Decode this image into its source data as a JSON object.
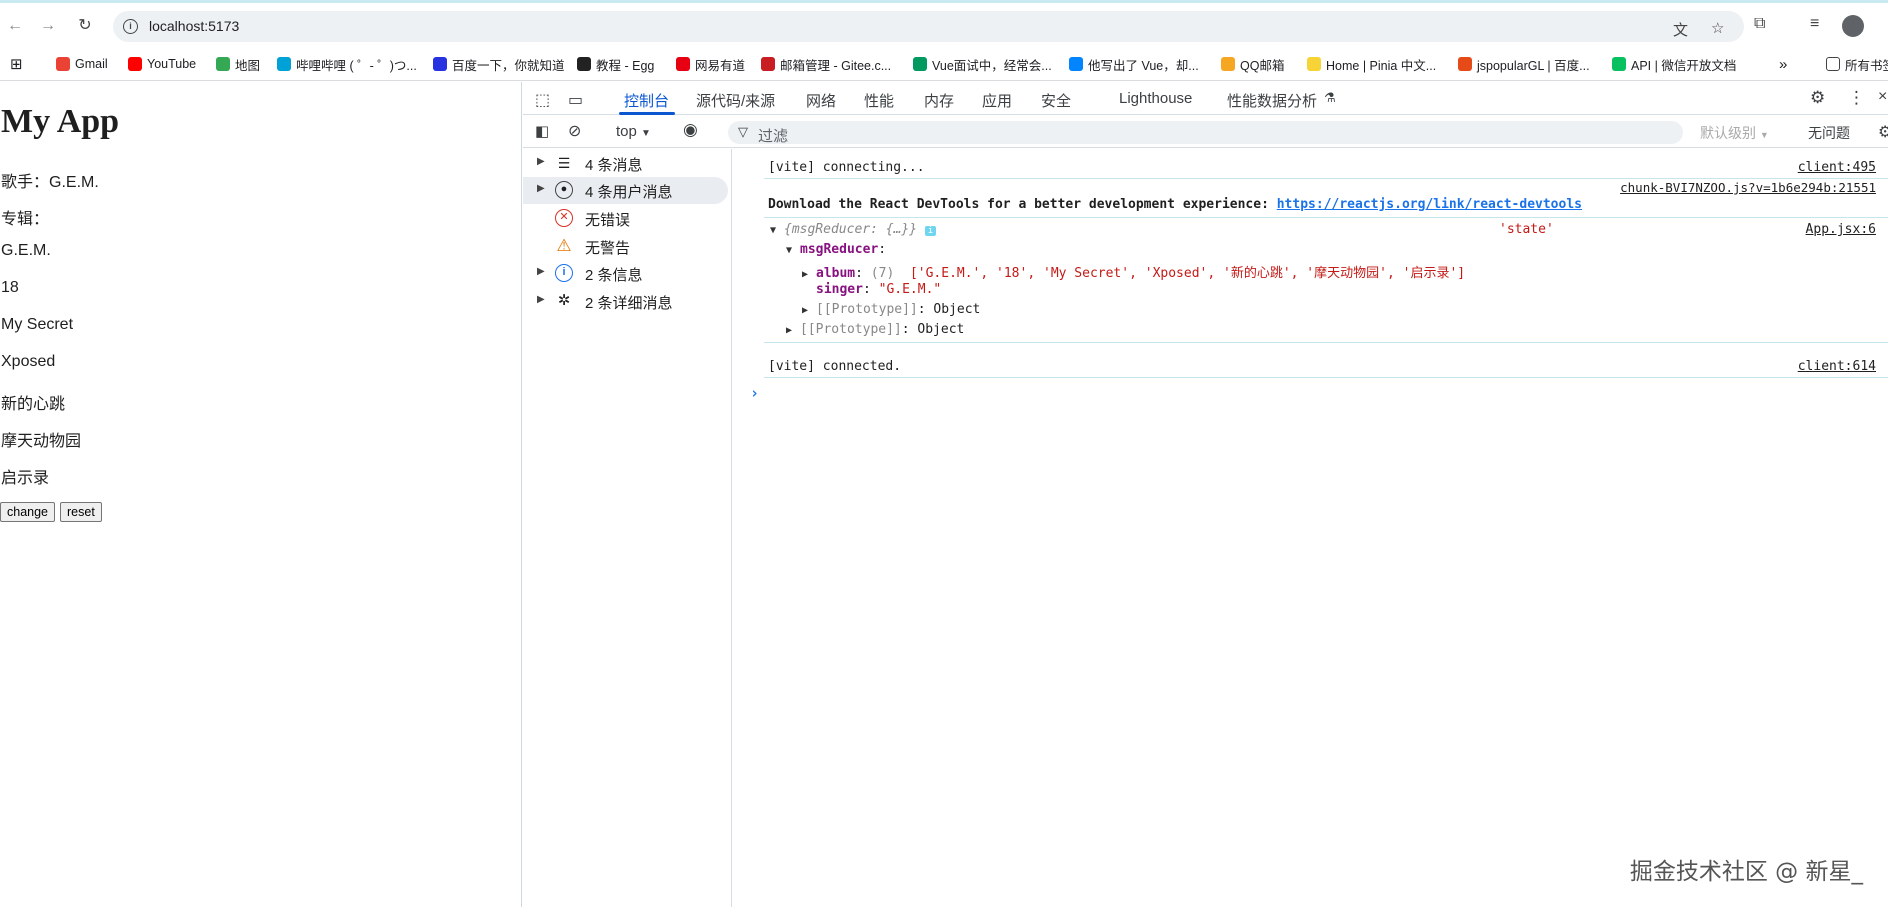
{
  "browser": {
    "url": "localhost:5173",
    "bookmarks": [
      {
        "label": "Gmail",
        "color": "#ea4335"
      },
      {
        "label": "YouTube",
        "color": "#ff0000"
      },
      {
        "label": "地图",
        "color": "#34a853"
      },
      {
        "label": "哔哩哔哩 ( ゜- ゜)つ...",
        "color": "#00a1d6"
      },
      {
        "label": "百度一下，你就知道",
        "color": "#2932e1"
      },
      {
        "label": "教程 - Egg",
        "color": "#222222"
      },
      {
        "label": "网易有道",
        "color": "#e60012"
      },
      {
        "label": "邮箱管理 - Gitee.c...",
        "color": "#c71d23"
      },
      {
        "label": "Vue面试中，经常会...",
        "color": "#009a61"
      },
      {
        "label": "他写出了 Vue，却...",
        "color": "#0084ff"
      },
      {
        "label": "QQ邮箱",
        "color": "#f5a623"
      },
      {
        "label": "Home | Pinia 中文...",
        "color": "#f7d336"
      },
      {
        "label": "jspopularGL | 百度...",
        "color": "#e64a19"
      },
      {
        "label": "API | 微信开放文档",
        "color": "#07c160"
      }
    ],
    "bookmarks_more": "»",
    "all_bookmarks": "所有书签"
  },
  "page": {
    "title": "My App",
    "singer_line": "歌手：G.E.M.",
    "album_label": "专辑：",
    "albums": [
      "G.E.M.",
      "18",
      "My Secret",
      "Xposed",
      "新的心跳",
      "摩天动物园",
      "启示录"
    ],
    "change_button": "change",
    "reset_button": "reset"
  },
  "devtools": {
    "tabs": [
      "控制台",
      "源代码/来源",
      "网络",
      "性能",
      "内存",
      "应用",
      "安全",
      "Lighthouse",
      "性能数据分析"
    ],
    "context": "top",
    "filter_placeholder": "过滤",
    "level": "默认级别",
    "issues": "无问题",
    "sidebar": [
      {
        "label": "4 条消息",
        "icon": "list-icon"
      },
      {
        "label": "4 条用户消息",
        "icon": "user-icon"
      },
      {
        "label": "无错误",
        "icon": "error-icon"
      },
      {
        "label": "无警告",
        "icon": "warning-icon"
      },
      {
        "label": "2 条信息",
        "icon": "info-icon"
      },
      {
        "label": "2 条详细消息",
        "icon": "bug-icon"
      }
    ],
    "console": {
      "line1": "[vite] connecting...",
      "line1_src": "client:495",
      "line2_src": "chunk-BVI7NZOO.js?v=1b6e294b:21551",
      "line2_text": "Download the React DevTools for a better development experience: ",
      "line2_link": "https://reactjs.org/link/react-devtools",
      "obj_summary": "{msgReducer: {…}}",
      "obj_label": "'state'",
      "obj_src": "App.jsx:6",
      "obj_key": "msgReducer",
      "album_key": "album",
      "album_count": "(7)",
      "album_values": "['G.E.M.', '18', 'My Secret', 'Xposed', '新的心跳', '摩天动物园', '启示录']",
      "singer_key": "singer",
      "singer_value": "\"G.E.M.\"",
      "proto_key": "[[Prototype]]",
      "proto_value": "Object",
      "line4": "[vite] connected.",
      "line4_src": "client:614"
    }
  },
  "watermark": "掘金技术社区 @ 新星_"
}
